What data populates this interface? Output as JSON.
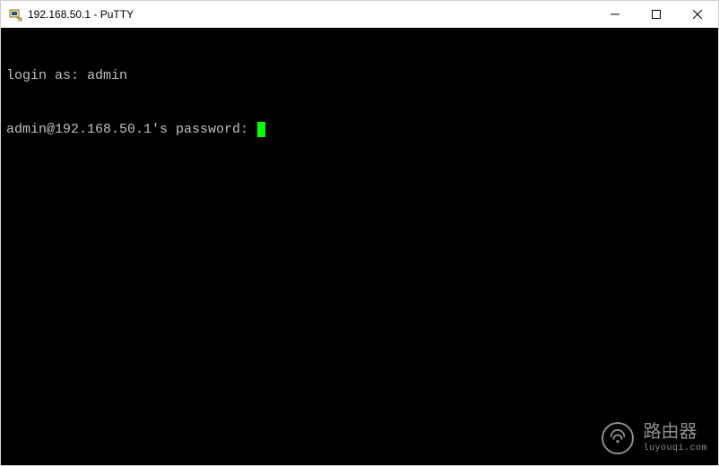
{
  "window": {
    "title": "192.168.50.1 - PuTTY"
  },
  "terminal": {
    "line1": "login as: admin",
    "line2": "admin@192.168.50.1's password: "
  },
  "watermark": {
    "label": "路由器",
    "sub": "luyouqi.com"
  }
}
